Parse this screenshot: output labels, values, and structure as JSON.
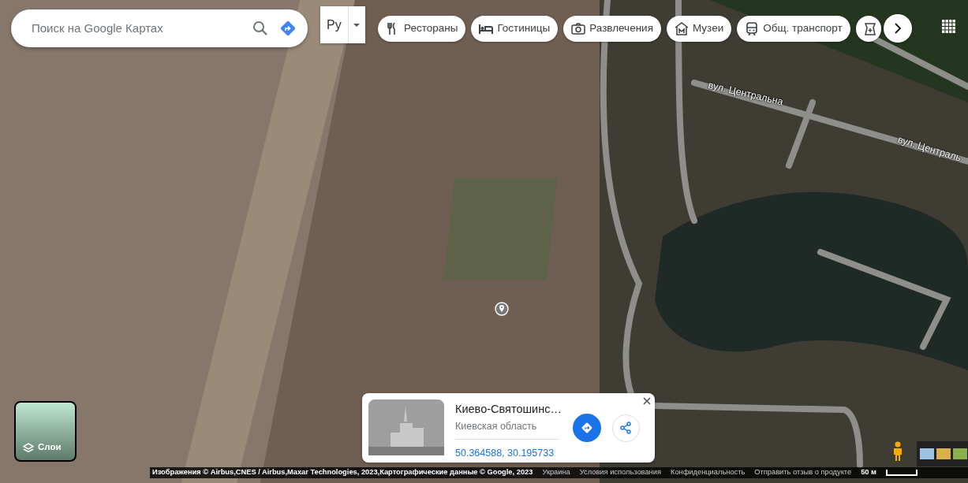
{
  "search": {
    "placeholder": "Поиск на Google Картах"
  },
  "label_toggle": {
    "label": "Ру"
  },
  "categories": [
    {
      "kind": "restaurant",
      "label": "Рестораны"
    },
    {
      "kind": "hotel",
      "label": "Гостиницы"
    },
    {
      "kind": "camera",
      "label": "Развлечения"
    },
    {
      "kind": "museum",
      "label": "Музеи"
    },
    {
      "kind": "transit",
      "label": "Общ. транспорт"
    },
    {
      "kind": "pharmacy"
    }
  ],
  "street_labels": [
    "вул. Центральна",
    "вул. Централь"
  ],
  "layers": {
    "label": "Слои"
  },
  "place_card": {
    "title": "Киево-Святошинс…",
    "subtitle": "Киевская область",
    "coordinates": "50.364588, 30.195733"
  },
  "footer": {
    "attribution": "Изображения © Airbus,CNES / Airbus,Maxar Technologies, 2023,Картографические данные © Google, 2023",
    "links": [
      "Украина",
      "Условия использования",
      "Конфиденциальность",
      "Отправить отзыв о продукте"
    ],
    "scale": "50 м"
  }
}
